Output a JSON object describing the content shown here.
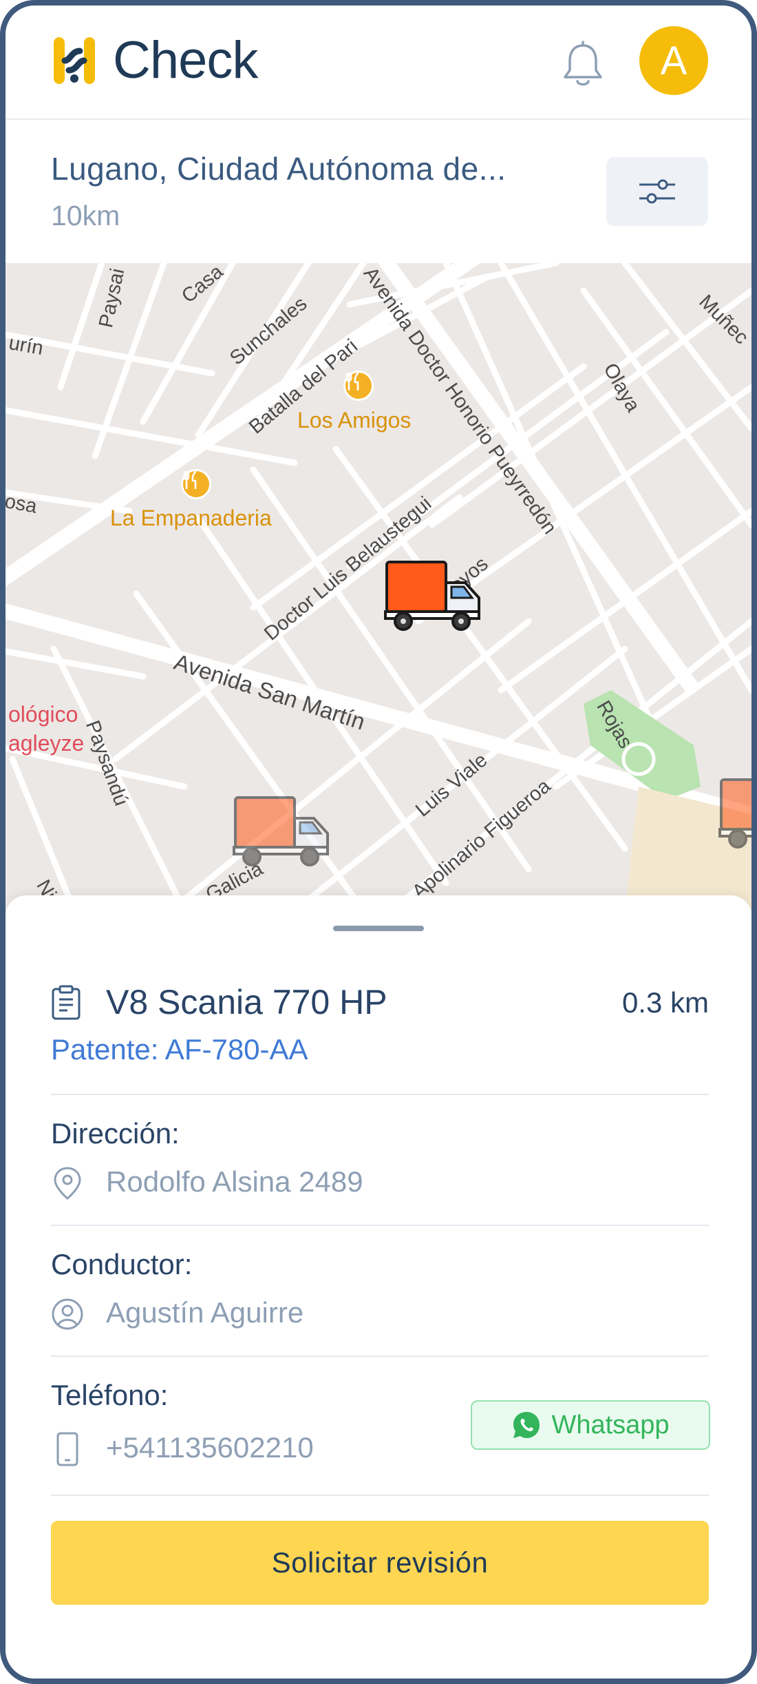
{
  "app": {
    "brand": "Check",
    "avatar_initial": "A"
  },
  "location": {
    "name": "Lugano, Ciudad Autónoma de...",
    "radius": "10km"
  },
  "map": {
    "streets": [
      "Paysandú",
      "Sunchales",
      "Batalla del Pari",
      "Avenida Doctor Honorio Pueyrredón",
      "Olaya",
      "Doctor Luis Belaustegui",
      "Avenida San Martín",
      "Luis Viale",
      "Rojas",
      "Galicia",
      "Paysai",
      "Casa",
      "urín",
      "osa",
      "Muñec",
      "Apolinario Figueroa",
      "oyos",
      "Ni"
    ],
    "poi": [
      {
        "name": "Los Amigos"
      },
      {
        "name": "La Empanaderia"
      },
      {
        "name_line1": "ológico",
        "name_line2": "agleyze"
      }
    ]
  },
  "vehicle": {
    "name": "V8 Scania 770 HP",
    "distance": "0.3 km",
    "plate": "Patente: AF-780-AA"
  },
  "details": {
    "address_label": "Dirección:",
    "address_value": "Rodolfo Alsina 2489",
    "driver_label": "Conductor:",
    "driver_value": "Agustín Aguirre",
    "phone_label": "Teléfono:",
    "phone_value": "+541135602210",
    "whatsapp_label": "Whatsapp"
  },
  "actions": {
    "request_review": "Solicitar revisión"
  },
  "colors": {
    "brand_yellow": "#f5bd0a",
    "cta_yellow": "#fed651",
    "primary_text": "#2a4467",
    "link_blue": "#3f7ad6",
    "truck_orange": "#ff5a1a",
    "whatsapp_green": "#33b55b"
  }
}
